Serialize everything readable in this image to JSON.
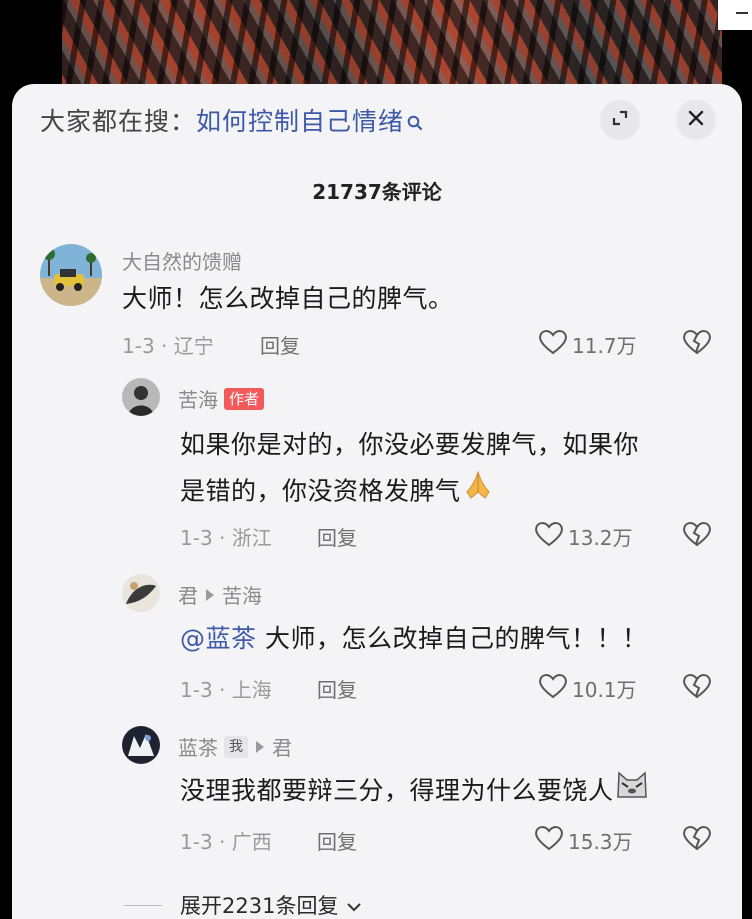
{
  "header": {
    "search_prefix": "大家都在搜：",
    "search_query": "如何控制自己情绪"
  },
  "comment_count": "21737条评论",
  "comments": [
    {
      "username": "大自然的馈赠",
      "text": "大师！怎么改掉自己的脾气。",
      "meta": "1-3 · 辽宁",
      "reply_label": "回复",
      "likes": "11.7万"
    },
    {
      "username": "苦海",
      "badge": "作者",
      "text_line1": "如果你是对的，你没必要发脾气，如果你",
      "text_line2": "是错的，你没资格发脾气",
      "meta": "1-3 · 浙江",
      "reply_label": "回复",
      "likes": "13.2万"
    },
    {
      "username": "君",
      "reply_to": "苦海",
      "mention": "@蓝茶",
      "text": " 大师，怎么改掉自己的脾气！！！",
      "meta": "1-3 · 上海",
      "reply_label": "回复",
      "likes": "10.1万"
    },
    {
      "username": "蓝茶",
      "badge": "我",
      "reply_to": "君",
      "text": "没理我都要辩三分，得理为什么要饶人",
      "meta": "1-3 · 广西",
      "reply_label": "回复",
      "likes": "15.3万"
    }
  ],
  "expand_replies": "展开2231条回复",
  "icons": {
    "search": "search-icon",
    "expand": "expand-icon",
    "close": "close-icon",
    "like": "heart-icon",
    "dislike": "broken-heart-icon",
    "pray_emoji": "pray-emoji-icon",
    "cat_emoji": "cat-emoji-icon",
    "chevron": "chevron-down-icon"
  },
  "colors": {
    "link": "#3d5aa8",
    "author_badge": "#f2595a",
    "sheet_bg": "#f4f3f5"
  }
}
